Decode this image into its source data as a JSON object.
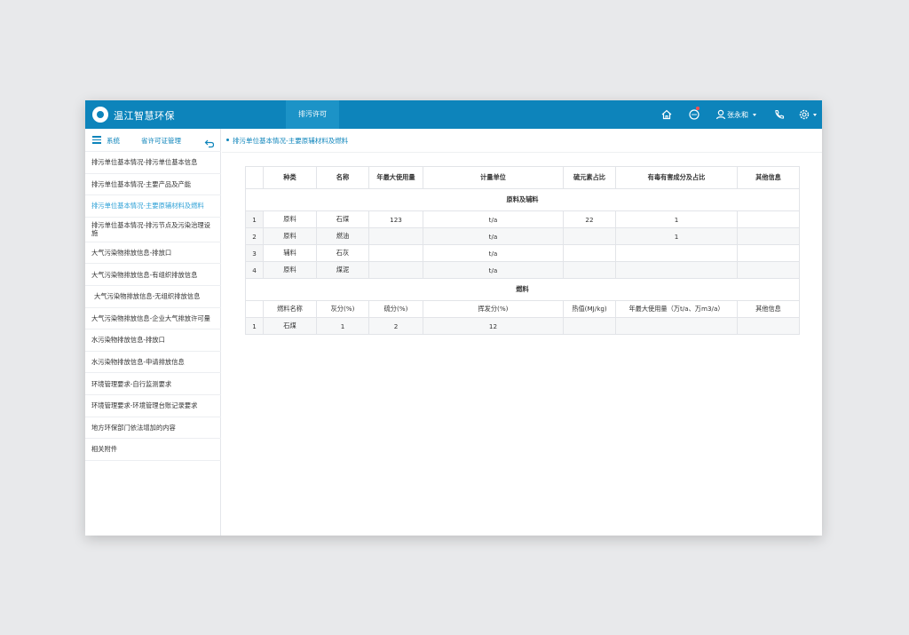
{
  "header": {
    "app_title": "温江智慧环保",
    "active_tab": "排污许可",
    "user_name": "张永和",
    "icons": [
      "home-icon",
      "message-icon",
      "user-icon",
      "phone-icon",
      "settings-icon"
    ],
    "accent_color": "#0d84bb"
  },
  "sidebar": {
    "system_label": "系统",
    "module_label": "省许可证管理",
    "items": [
      {
        "label": "排污单位基本情况-排污单位基本信息"
      },
      {
        "label": "排污单位基本情况-主要产品及产能"
      },
      {
        "label": "排污单位基本情况-主要原辅材料及燃料"
      },
      {
        "label": "排污单位基本情况-排污节点及污染治理设施"
      },
      {
        "label": "大气污染物排放信息-排放口"
      },
      {
        "label": "大气污染物排放信息-有组织排放信息"
      },
      {
        "label": "大气污染物排放信息-无组织排放信息"
      },
      {
        "label": "大气污染物排放信息-企业大气排放许可量"
      },
      {
        "label": "水污染物排放信息-排放口"
      },
      {
        "label": "水污染物排放信息-申请排放信息"
      },
      {
        "label": "环境管理要求-自行监测要求"
      },
      {
        "label": "环境管理要求-环境管理台账记录要求"
      },
      {
        "label": "地方环保部门依法增加的内容"
      },
      {
        "label": "相关附件"
      }
    ]
  },
  "breadcrumb": "排污单位基本情况-主要原辅材料及燃料",
  "materials": {
    "columns": [
      "种类",
      "名称",
      "年最大使用量",
      "计量单位",
      "硫元素占比",
      "有毒有害成分及占比",
      "其他信息"
    ],
    "section_title": "原料及辅料",
    "rows": [
      {
        "idx": "1",
        "type": "原料",
        "name": "石煤",
        "max_use": "123",
        "unit": "t/a",
        "sulfur": "22",
        "toxic": "1",
        "other": ""
      },
      {
        "idx": "2",
        "type": "原料",
        "name": "燃油",
        "max_use": "",
        "unit": "t/a",
        "sulfur": "",
        "toxic": "1",
        "other": ""
      },
      {
        "idx": "3",
        "type": "辅料",
        "name": "石灰",
        "max_use": "",
        "unit": "t/a",
        "sulfur": "",
        "toxic": "",
        "other": ""
      },
      {
        "idx": "4",
        "type": "原料",
        "name": "煤泥",
        "max_use": "",
        "unit": "t/a",
        "sulfur": "",
        "toxic": "",
        "other": ""
      }
    ]
  },
  "fuel": {
    "section_title": "燃料",
    "columns": [
      "燃料名称",
      "灰分(%)",
      "硫分(%)",
      "挥发分(%)",
      "热值(MJ/kg)",
      "年最大使用量（万t/a、万m3/a）",
      "其他信息"
    ],
    "rows": [
      {
        "idx": "1",
        "name": "石煤",
        "ash": "1",
        "sulfur": "2",
        "volatile": "12",
        "heat": "",
        "max_use": "",
        "other": ""
      }
    ]
  }
}
